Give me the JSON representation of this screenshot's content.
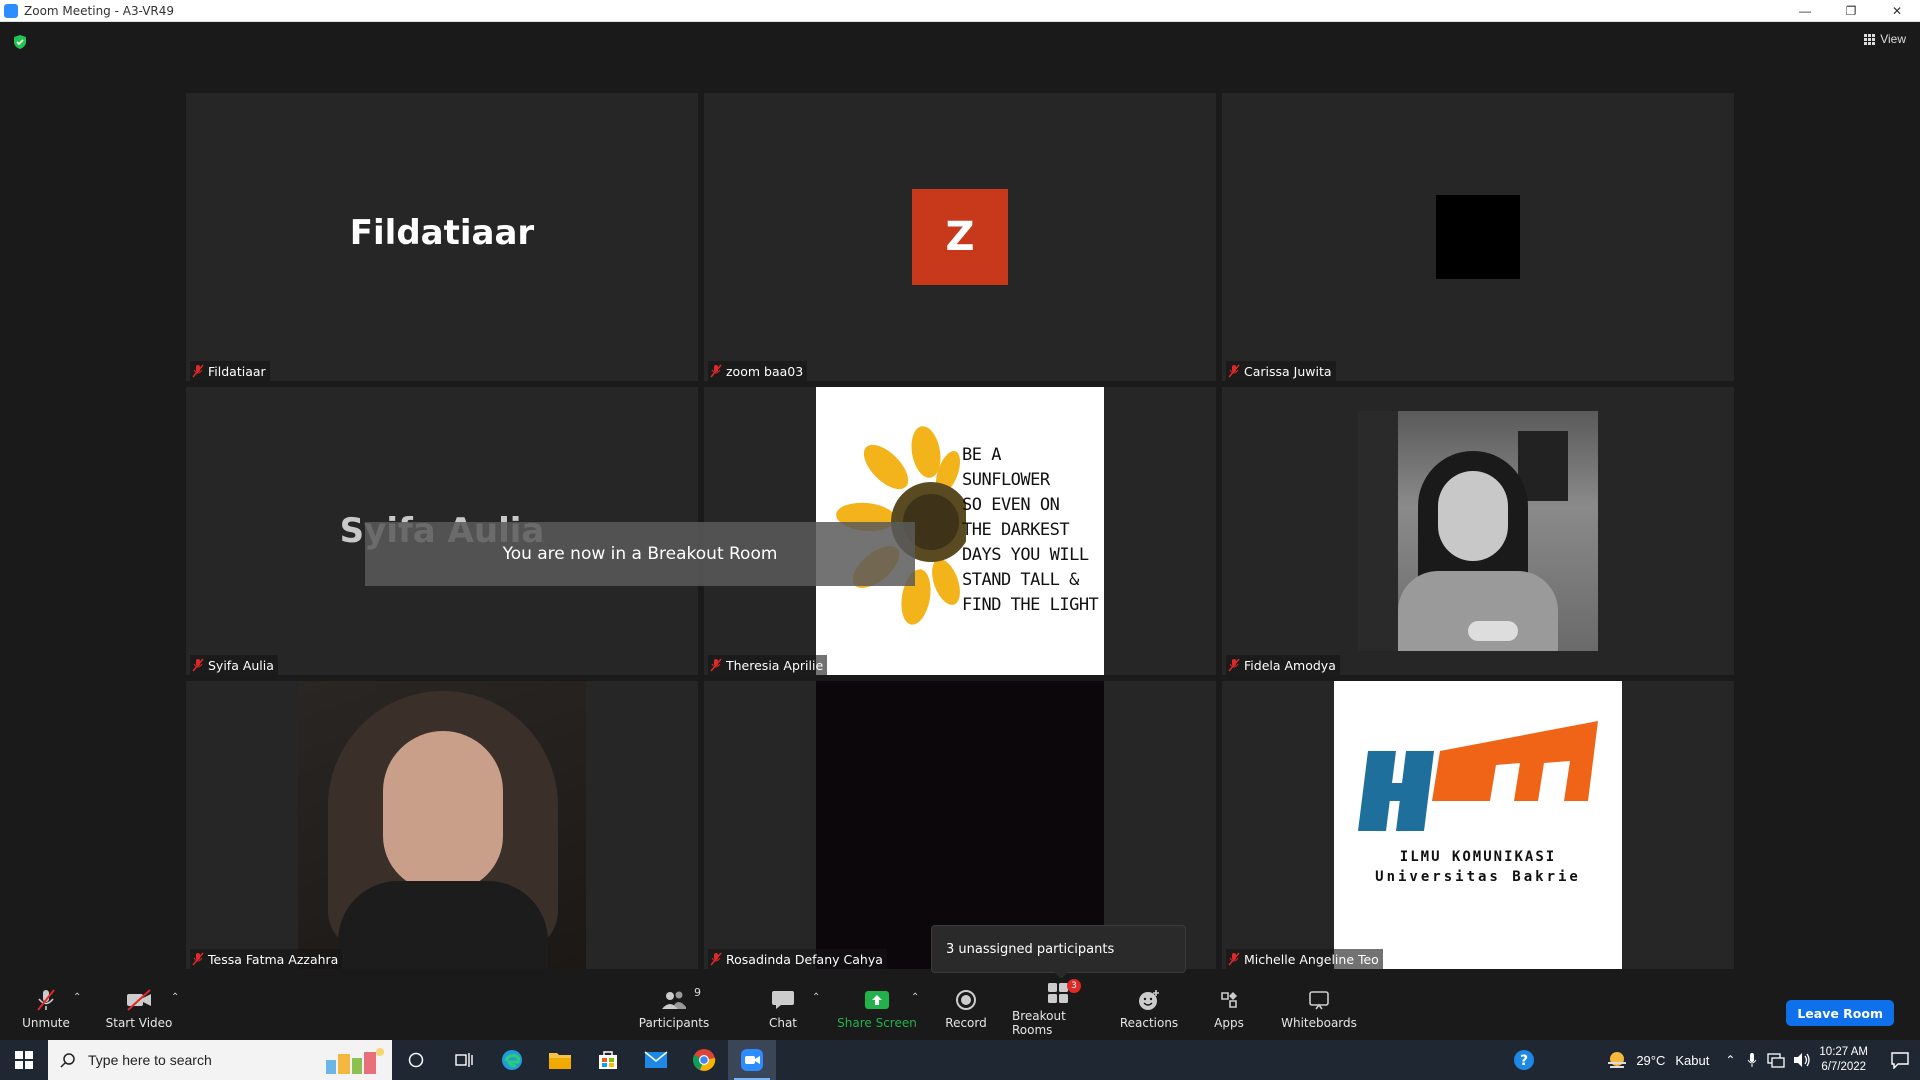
{
  "window": {
    "title": "Zoom Meeting - A3-VR49"
  },
  "top": {
    "view_label": "View"
  },
  "tiles": [
    {
      "label": "Fildatiaar",
      "display_name": "Fildatiaar"
    },
    {
      "label": "zoom baa03",
      "avatar_letter": "Z"
    },
    {
      "label": "Carissa Juwita"
    },
    {
      "label": "Syifa Aulia",
      "display_name": "Syifa Aulia"
    },
    {
      "label": "Theresia Aprilie",
      "poster_text": [
        "BE A",
        "SUNFLOWER",
        "SO EVEN ON",
        "THE DARKEST",
        "DAYS YOU WILL",
        "STAND TALL &",
        "FIND THE LIGHT"
      ]
    },
    {
      "label": "Fidela Amodya"
    },
    {
      "label": "Tessa Fatma Azzahra"
    },
    {
      "label": "Rosadinda Defany Cahya"
    },
    {
      "label": "Michelle Angeline Teo",
      "logo_line1": "ILMU KOMUNIKASI",
      "logo_line2": "Universitas Bakrie"
    }
  ],
  "toast": "You are now in a Breakout Room",
  "tooltip": "3 unassigned participants",
  "toolbar": {
    "unmute": "Unmute",
    "start_video": "Start Video",
    "participants": "Participants",
    "participants_count": "9",
    "chat": "Chat",
    "share_screen": "Share Screen",
    "record": "Record",
    "breakout_rooms": "Breakout Rooms",
    "breakout_badge": "3",
    "reactions": "Reactions",
    "apps": "Apps",
    "whiteboards": "Whiteboards",
    "leave_room": "Leave Room"
  },
  "taskbar": {
    "search_placeholder": "Type here to search",
    "weather_temp": "29°C",
    "weather_desc": "Kabut",
    "time": "10:27 AM",
    "date": "6/7/2022"
  },
  "colors": {
    "accent": "#0e71eb",
    "share_green": "#22b14c",
    "muted_red": "#e02828",
    "avatar_orange": "#c7391a"
  }
}
